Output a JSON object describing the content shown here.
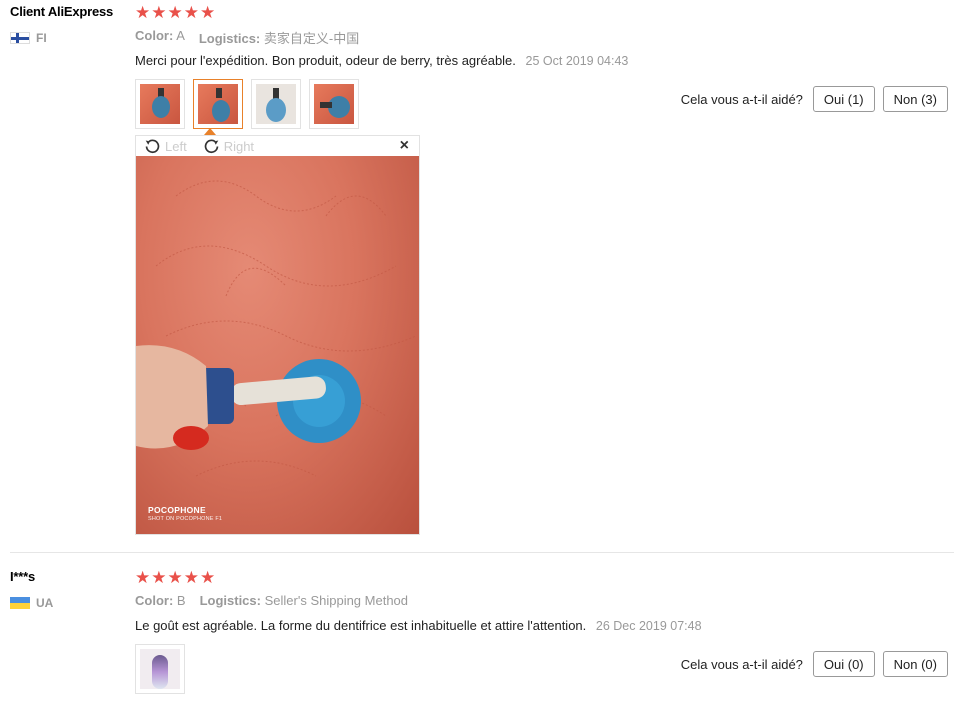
{
  "reviews": [
    {
      "author": "Client AliExpress",
      "country": "FI",
      "rating": "★★★★★",
      "color_label": "Color:",
      "color_value": "A",
      "logistics_label": "Logistics:",
      "logistics_value": "卖家自定义-中国",
      "comment": "Merci pour l'expédition. Bon produit, odeur de berry, très agréable.",
      "date": "25 Oct 2019 04:43",
      "helpful_label": "Cela vous a-t-il aidé?",
      "yes_label": "Oui (1)",
      "no_label": "Non (3)"
    },
    {
      "author": "I***s",
      "country": "UA",
      "rating": "★★★★★",
      "color_label": "Color:",
      "color_value": "B",
      "logistics_label": "Logistics:",
      "logistics_value": "Seller's Shipping Method",
      "comment": "Le goût est agréable. La forme du dentifrice est inhabituelle et attire l'attention.",
      "date": "26 Dec 2019 07:48",
      "helpful_label": "Cela vous a-t-il aidé?",
      "yes_label": "Oui (0)",
      "no_label": "Non (0)"
    }
  ],
  "viewer": {
    "rotate_left": "Left",
    "rotate_right": "Right",
    "close": "×",
    "watermark_brand": "POCOPHONE",
    "watermark_sub": "SHOT ON POCOPHONE F1"
  },
  "colors": {
    "star": "#e9514a",
    "active_thumb": "#e8812a"
  }
}
